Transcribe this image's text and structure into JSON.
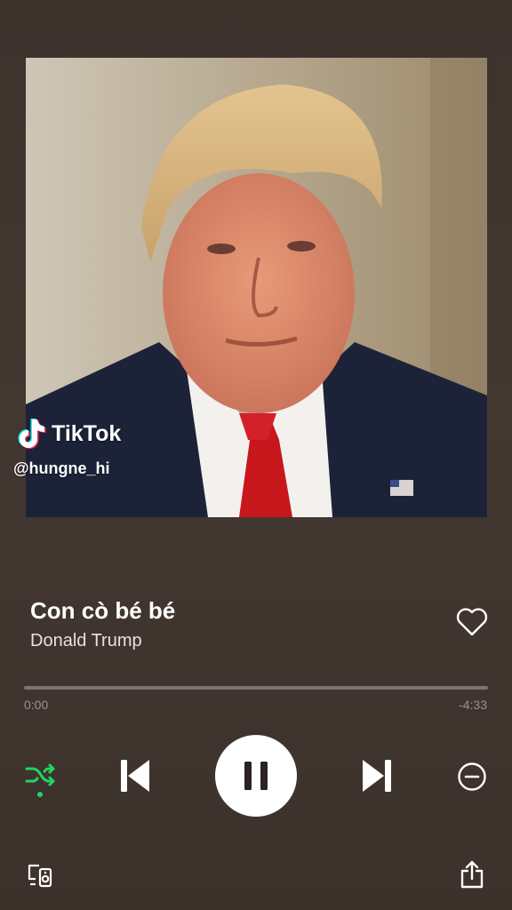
{
  "album_art": {
    "description_icon": "album-cover-portrait"
  },
  "watermark": {
    "brand": "TikTok",
    "handle": "@hungne_hi"
  },
  "track": {
    "title": "Con cò bé bé",
    "artist": "Donald Trump",
    "liked": false
  },
  "progress": {
    "fraction": 0.0,
    "elapsed": "0:00",
    "remaining": "-4:33"
  },
  "controls": {
    "shuffle_icon": "shuffle-icon",
    "shuffle_active": true,
    "previous_icon": "skip-previous-icon",
    "play_state": "playing",
    "pause_icon": "pause-icon",
    "next_icon": "skip-next-icon",
    "remove_icon": "minus-circle-icon",
    "devices_icon": "devices-icon",
    "share_icon": "share-icon"
  },
  "colors": {
    "accent": "#1ed760",
    "background": "#403430",
    "muted_text": "#9a928e"
  }
}
